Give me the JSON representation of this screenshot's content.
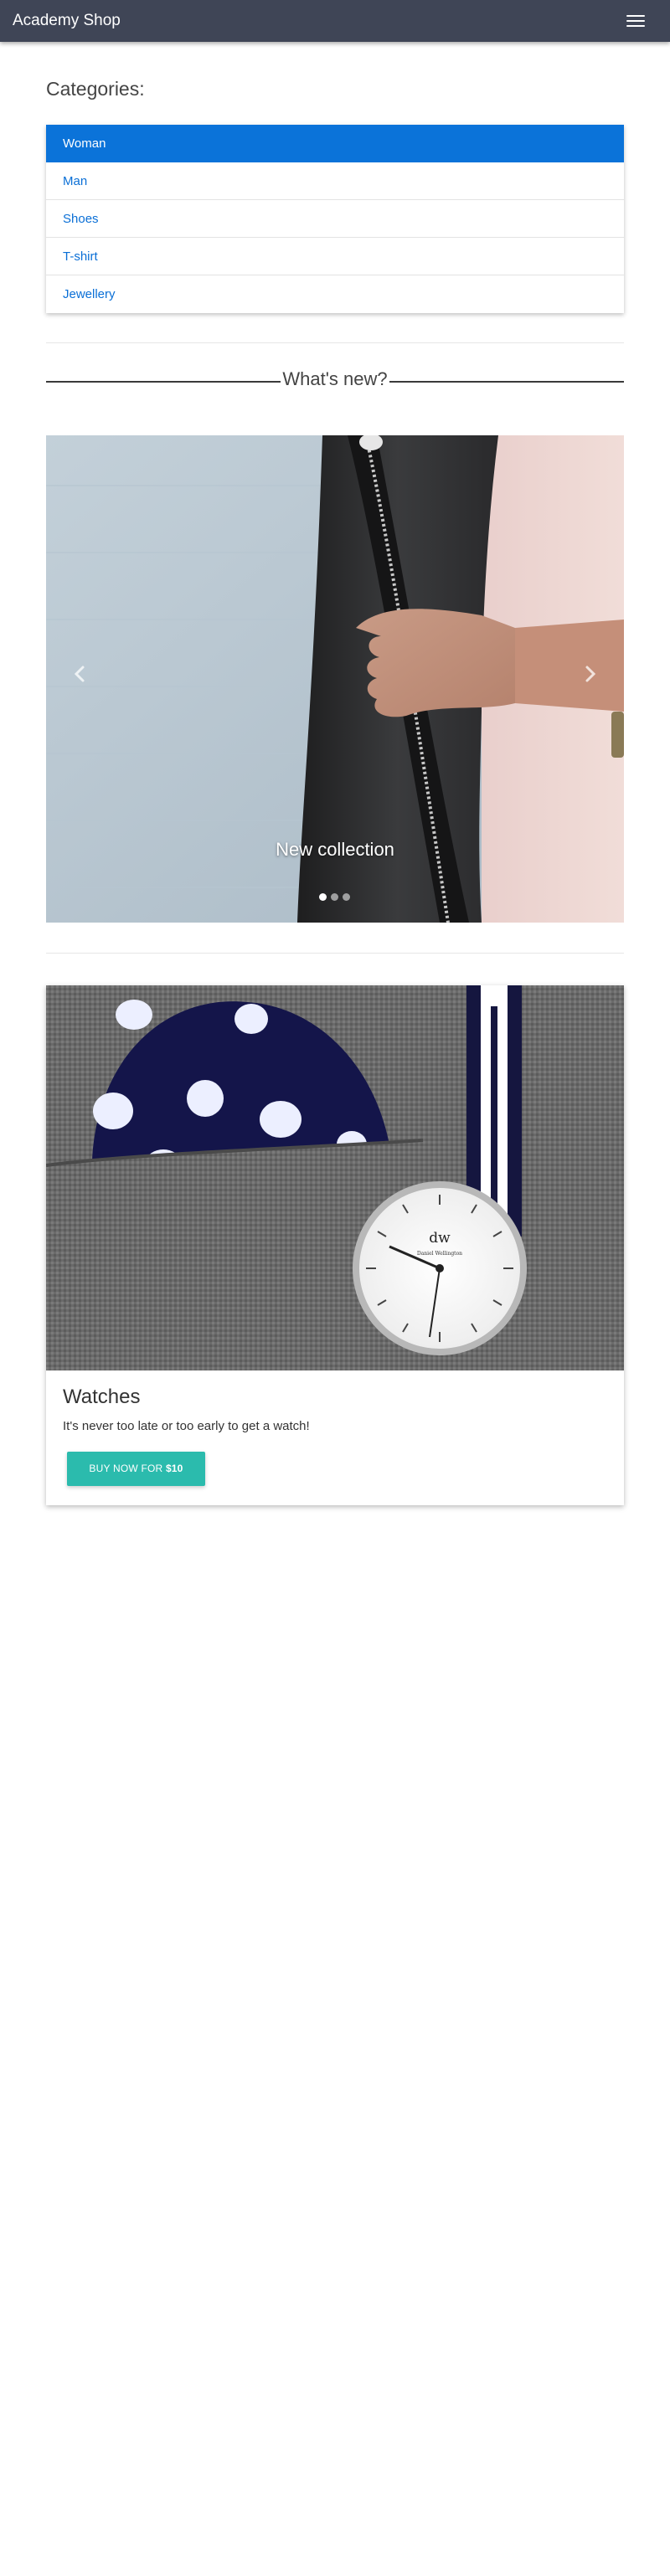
{
  "navbar": {
    "brand": "Academy Shop",
    "menu_icon": "hamburger-menu-icon"
  },
  "categories": {
    "title": "Categories:",
    "items": [
      {
        "label": "Woman",
        "active": true
      },
      {
        "label": "Man",
        "active": false
      },
      {
        "label": "Shoes",
        "active": false
      },
      {
        "label": "T-shirt",
        "active": false
      },
      {
        "label": "Jewellery",
        "active": false
      }
    ]
  },
  "whats_new": {
    "title": "What's new?"
  },
  "carousel": {
    "caption": "New collection",
    "slide_count": 3,
    "active_slide": 1,
    "prev_icon": "chevron-left-icon",
    "next_icon": "chevron-right-icon"
  },
  "product_card": {
    "title": "Watches",
    "text": "It's never too late or too early to get a watch!",
    "button_prefix": "Buy now for ",
    "button_price": "$10",
    "watch_logo": "dw",
    "watch_brand": "Daniel Wellington"
  },
  "colors": {
    "navbar": "#3f4556",
    "active_item": "#0b73d9",
    "link": "#0a6fd6",
    "button": "#2bbbad"
  }
}
